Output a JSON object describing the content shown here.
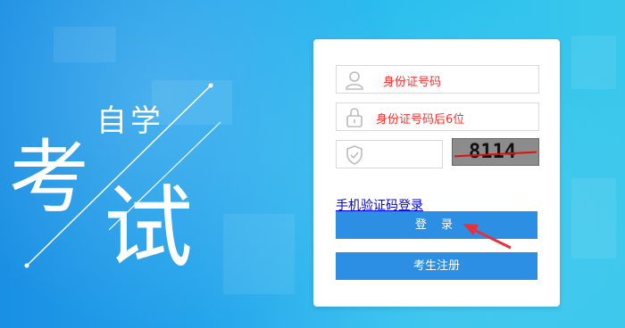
{
  "art": {
    "char1": "自",
    "char2": "学",
    "char3": "考",
    "char4": "试"
  },
  "form": {
    "id_placeholder": "身份证号码",
    "password_placeholder": "身份证号码后6位",
    "captcha_text": "8114",
    "sms_login_link": "手机验证码登录",
    "login_button": "登 录",
    "register_button": "考生注册"
  },
  "colors": {
    "accent": "#2d8fe3",
    "placeholder": "#ff2e2e",
    "link": "#0000ee"
  },
  "icons": {
    "id_field": "user-icon",
    "password_field": "lock-icon",
    "captcha_field": "shield-icon",
    "annotation": "red-arrow-icon"
  }
}
